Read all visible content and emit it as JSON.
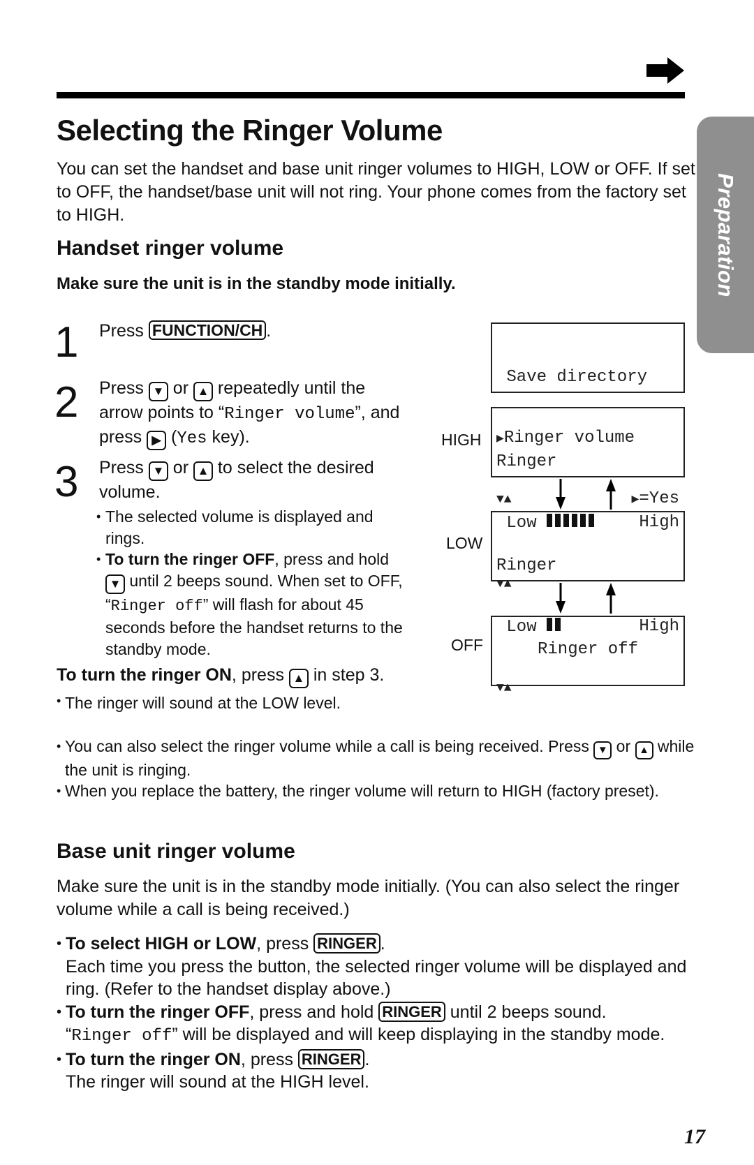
{
  "page": {
    "title": "Selecting the Ringer Volume",
    "side_tab": "Preparation",
    "page_number": "17",
    "continue_icon": "right-arrow-icon"
  },
  "intro": "You can set the handset and base unit ringer volumes to HIGH, LOW or OFF. If set to OFF, the handset/base unit will not ring. Your phone comes from the factory set to HIGH.",
  "handset": {
    "heading": "Handset ringer volume",
    "standby_note": "Make sure the unit is in the standby mode initially.",
    "steps": [
      {
        "num": "1",
        "pre": "Press ",
        "key": "FUNCTION/CH",
        "post": "."
      },
      {
        "num": "2",
        "pre": "Press ",
        "key_down": "▼",
        "mid1": " or ",
        "key_up": "▲",
        "mid2": " repeatedly until the arrow points to “",
        "mono": "Ringer volume",
        "mid3": "”, and press ",
        "key_right": "▶",
        "mid4": " (",
        "mono2": "Yes",
        "post": " key)."
      },
      {
        "num": "3",
        "pre": "Press ",
        "key_down": "▼",
        "mid1": " or ",
        "key_up": "▲",
        "post": " to select the desired volume."
      }
    ],
    "step3_bullets": {
      "b1": "The selected volume is displayed and rings.",
      "b2_bold": "To turn the ringer OFF",
      "b2_pre": ", press and hold ",
      "b2_key": "▼",
      "b2_mid": " until 2 beeps sound. When set to OFF, “",
      "b2_mono": "Ringer off",
      "b2_post": "” will flash for about 45 seconds before the handset returns to the standby mode."
    },
    "ring_on": {
      "bold": "To turn the ringer ON",
      "pre": ", press ",
      "key": "▲",
      "post": " in step 3.",
      "note": "The ringer will sound at the LOW level."
    },
    "notes": {
      "n1_pre": "You can also select the ringer volume while a call is being received. Press ",
      "n1_key1": "▼",
      "n1_mid": " or ",
      "n1_key2": "▲",
      "n1_post": " while the unit is ringing.",
      "n2": "When you replace the battery, the ringer volume will return to HIGH (factory preset)."
    }
  },
  "displays": {
    "menu": {
      "line1": " Save directory",
      "line2_marker": "▶",
      "line2": "Ringer volume",
      "nav": "▼▲",
      "yes_marker": "▶",
      "yes": "=Yes"
    },
    "levels": [
      {
        "label": "HIGH",
        "line1": "Ringer",
        "low": " Low",
        "high": "High",
        "nav": "▼▲",
        "level_bars": 6,
        "max_bars": 6
      },
      {
        "label": "LOW",
        "line1": "Ringer",
        "low": " Low",
        "high": "High",
        "nav": "▼▲",
        "level_bars": 2,
        "max_bars": 6
      },
      {
        "label": "OFF",
        "text": "Ringer off"
      }
    ]
  },
  "base": {
    "heading": "Base unit ringer volume",
    "intro": "Make sure the unit is in the standby mode initially. (You can also select the ringer volume while a call is being received.)",
    "b1_bold": "To select HIGH or LOW",
    "b1_pre": ", press ",
    "b1_key": "RINGER",
    "b1_post": ".",
    "b1_detail": "Each time you press the button, the selected ringer volume will be displayed and ring. (Refer to the handset display above.)",
    "b2_bold": "To turn the ringer OFF",
    "b2_pre": ", press and hold ",
    "b2_key": "RINGER",
    "b2_post": " until 2 beeps sound.",
    "b2_detail_pre": "“",
    "b2_detail_mono": "Ringer off",
    "b2_detail_post": "” will be displayed and will keep displaying in the standby mode.",
    "b3_bold": "To turn the ringer ON",
    "b3_pre": ", press ",
    "b3_key": "RINGER",
    "b3_post": ".",
    "b3_detail": "The ringer will sound at the HIGH level."
  }
}
